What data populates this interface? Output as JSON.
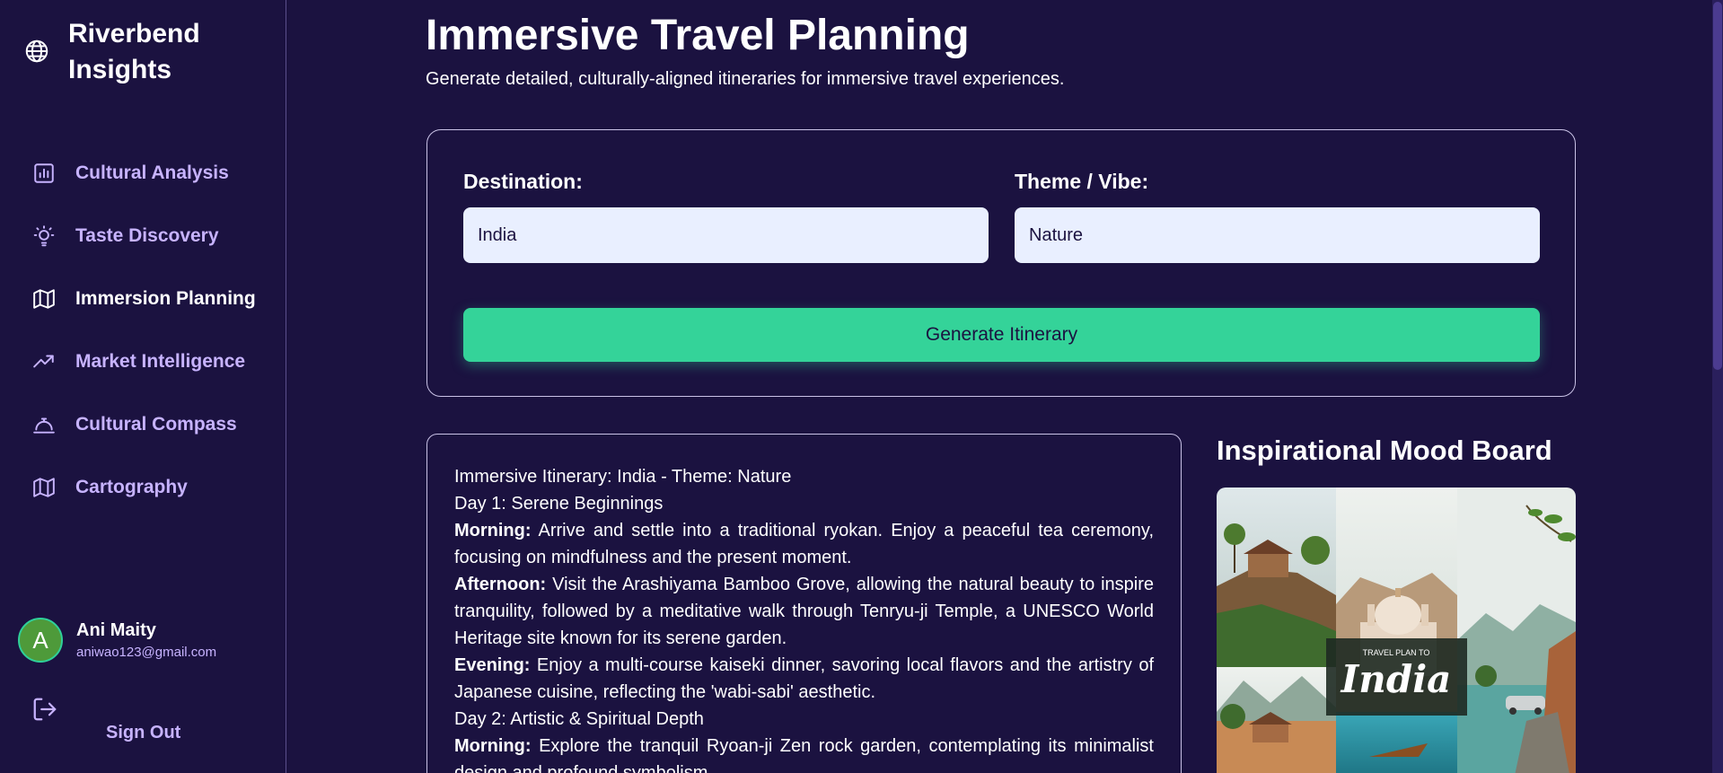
{
  "sidebar": {
    "brand": {
      "line1": "Riverbend",
      "line2": "Insights",
      "icon": "globe-icon"
    },
    "items": [
      {
        "label": "Cultural Analysis",
        "icon": "bar-chart-icon",
        "active": false
      },
      {
        "label": "Taste Discovery",
        "icon": "lightbulb-icon",
        "active": false
      },
      {
        "label": "Immersion Planning",
        "icon": "map-icon",
        "active": true
      },
      {
        "label": "Market Intelligence",
        "icon": "trending-up-icon",
        "active": false
      },
      {
        "label": "Cultural Compass",
        "icon": "concierge-bell-icon",
        "active": false
      },
      {
        "label": "Cartography",
        "icon": "map-icon",
        "active": false
      }
    ],
    "user": {
      "initial": "A",
      "name": "Ani Maity",
      "email": "aniwao123@gmail.com"
    },
    "sign_out": "Sign Out"
  },
  "main": {
    "title": "Immersive Travel Planning",
    "subtitle": "Generate detailed, culturally-aligned itineraries for immersive travel experiences.",
    "form": {
      "destination_label": "Destination:",
      "destination_value": "India",
      "theme_label": "Theme / Vibe:",
      "theme_value": "Nature",
      "generate_label": "Generate Itinerary"
    },
    "itinerary": {
      "heading": "Immersive Itinerary: India - Theme: Nature",
      "day1": "Day 1: Serene Beginnings",
      "d1_morning_label": "Morning:",
      "d1_morning": " Arrive and settle into a traditional ryokan. Enjoy a peaceful tea ceremony, focusing on mindfulness and the present moment.",
      "d1_afternoon_label": "Afternoon:",
      "d1_afternoon": " Visit the Arashiyama Bamboo Grove, allowing the natural beauty to inspire tranquility, followed by a meditative walk through Tenryu-ji Temple, a UNESCO World Heritage site known for its serene garden.",
      "d1_evening_label": "Evening:",
      "d1_evening": " Enjoy a multi-course kaiseki dinner, savoring local flavors and the artistry of Japanese cuisine, reflecting the 'wabi-sabi' aesthetic.",
      "day2": "Day 2: Artistic & Spiritual Depth",
      "d2_morning_label": "Morning:",
      "d2_morning": " Explore the tranquil Ryoan-ji Zen rock garden, contemplating its minimalist design and profound symbolism."
    },
    "mood_board": {
      "title": "Inspirational Mood Board",
      "overlay_small": "TRAVEL PLAN TO",
      "overlay_big": "India"
    }
  },
  "colors": {
    "background": "#1b1240",
    "accent_green": "#34d399",
    "nav_text": "#c7b3ff",
    "input_bg": "#e9efff"
  }
}
